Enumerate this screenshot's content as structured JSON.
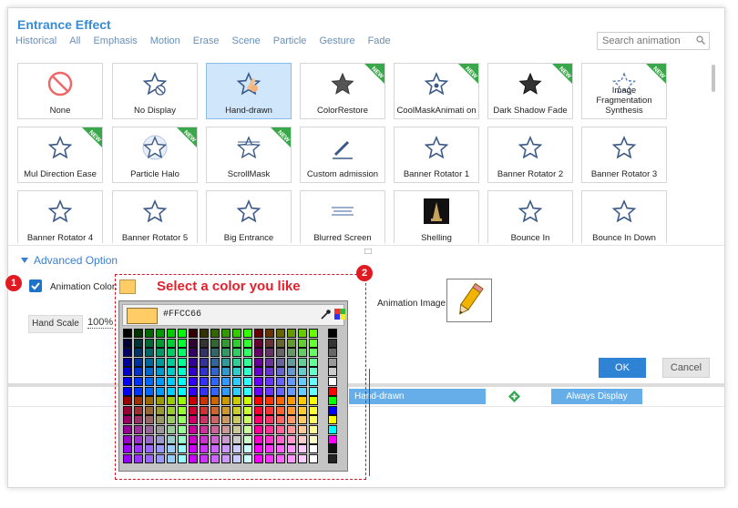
{
  "dialog": {
    "title": "Entrance Effect",
    "tabs": [
      "Historical",
      "All",
      "Emphasis",
      "Motion",
      "Erase",
      "Scene",
      "Particle",
      "Gesture",
      "Fade"
    ],
    "search_placeholder": "Search animation"
  },
  "effects": [
    {
      "label": "None",
      "icon": "no-entry-icon",
      "new": false,
      "selected": false
    },
    {
      "label": "No Display",
      "icon": "star-no-icon",
      "new": false,
      "selected": false
    },
    {
      "label": "Hand-drawn",
      "icon": "hand-drawn-star-icon",
      "new": false,
      "selected": true
    },
    {
      "label": "ColorRestore",
      "icon": "color-star-icon",
      "new": true,
      "selected": false
    },
    {
      "label": "CoolMaskAnimati on",
      "icon": "cool-mask-star-icon",
      "new": true,
      "selected": false
    },
    {
      "label": "Dark Shadow Fade",
      "icon": "dark-star-icon",
      "new": true,
      "selected": false
    },
    {
      "label": "Image Fragmentation Synthesis",
      "icon": "fragment-star-icon",
      "new": true,
      "selected": false
    },
    {
      "label": "Mul Direction Ease",
      "icon": "star-icon",
      "new": true,
      "selected": false
    },
    {
      "label": "Particle Halo",
      "icon": "halo-star-icon",
      "new": true,
      "selected": false
    },
    {
      "label": "ScrollMask",
      "icon": "scroll-star-icon",
      "new": true,
      "selected": false
    },
    {
      "label": "Custom admission",
      "icon": "pen-icon",
      "new": false,
      "selected": false
    },
    {
      "label": "Banner Rotator 1",
      "icon": "star-icon",
      "new": false,
      "selected": false
    },
    {
      "label": "Banner Rotator 2",
      "icon": "star-icon",
      "new": false,
      "selected": false
    },
    {
      "label": "Banner Rotator 3",
      "icon": "star-icon",
      "new": false,
      "selected": false
    },
    {
      "label": "Banner Rotator 4",
      "icon": "star-icon",
      "new": false,
      "selected": false
    },
    {
      "label": "Banner Rotator 5",
      "icon": "star-icon",
      "new": false,
      "selected": false
    },
    {
      "label": "Big Entrance",
      "icon": "star-icon",
      "new": false,
      "selected": false
    },
    {
      "label": "Blurred Screen",
      "icon": "blur-icon",
      "new": false,
      "selected": false
    },
    {
      "label": "Shelling",
      "icon": "shelling-thumbnail",
      "new": false,
      "selected": false
    },
    {
      "label": "Bounce In",
      "icon": "star-icon",
      "new": false,
      "selected": false
    },
    {
      "label": "Bounce In Down",
      "icon": "star-icon",
      "new": false,
      "selected": false
    }
  ],
  "new_badge_text": "NEW",
  "advanced": {
    "title": "Advanced Option",
    "animation_color_label": "Animation Color:",
    "animation_color_value": "#FFCC66",
    "hand_scale_label": "Hand Scale",
    "hand_scale_value": "100%",
    "animation_image_label": "Animation Image:"
  },
  "buttons": {
    "ok": "OK",
    "cancel": "Cancel"
  },
  "timeline": {
    "track_label": "Hand-drawn",
    "always_label": "Always Display"
  },
  "annotation": {
    "text": "Select a color you like",
    "step1": "1",
    "step2": "2"
  },
  "picker": {
    "hex": "#FFCC66"
  },
  "colors": {
    "accent": "#2e83d4",
    "selected_bg": "#cfe6fb",
    "badge_green": "#3aa84a",
    "annot_red": "#e5202d"
  }
}
